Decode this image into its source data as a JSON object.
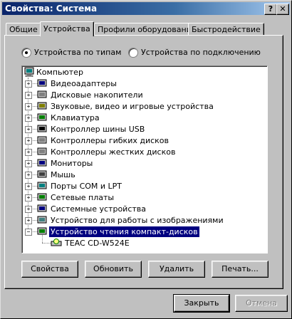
{
  "window": {
    "title": "Свойства: Система",
    "help_label": "?",
    "close_label": "✕"
  },
  "tabs": [
    {
      "label": "Общие"
    },
    {
      "label": "Устройства"
    },
    {
      "label": "Профили оборудования"
    },
    {
      "label": "Быстродействие"
    }
  ],
  "view_options": {
    "by_type": "Устройства по типам",
    "by_connection": "Устройства по подключению",
    "selected": "by_type"
  },
  "tree": {
    "root": "Компьютер",
    "items": [
      {
        "label": "Видеоадаптеры",
        "icon": "display-adapter-icon"
      },
      {
        "label": "Дисковые накопители",
        "icon": "disk-drive-icon"
      },
      {
        "label": "Звуковые, видео и игровые устройства",
        "icon": "sound-device-icon"
      },
      {
        "label": "Клавиатура",
        "icon": "keyboard-icon"
      },
      {
        "label": "Контроллер шины USB",
        "icon": "usb-icon"
      },
      {
        "label": "Контроллеры гибких дисков",
        "icon": "floppy-controller-icon"
      },
      {
        "label": "Контроллеры жестких дисков",
        "icon": "hdd-controller-icon"
      },
      {
        "label": "Мониторы",
        "icon": "monitor-icon"
      },
      {
        "label": "Мышь",
        "icon": "mouse-icon"
      },
      {
        "label": "Порты COM и LPT",
        "icon": "port-icon"
      },
      {
        "label": "Сетевые платы",
        "icon": "network-card-icon"
      },
      {
        "label": "Системные устройства",
        "icon": "system-device-icon"
      },
      {
        "label": "Устройство для работы с изображениями",
        "icon": "imaging-device-icon"
      },
      {
        "label": "Устройство чтения компакт-дисков",
        "icon": "cdrom-icon"
      }
    ],
    "child": {
      "label": "TEAC CD-W524E",
      "icon": "cd-drive-icon"
    }
  },
  "buttons": {
    "properties": "Свойства",
    "refresh": "Обновить",
    "remove": "Удалить",
    "print": "Печать...",
    "close": "Закрыть",
    "cancel": "Отмена"
  }
}
